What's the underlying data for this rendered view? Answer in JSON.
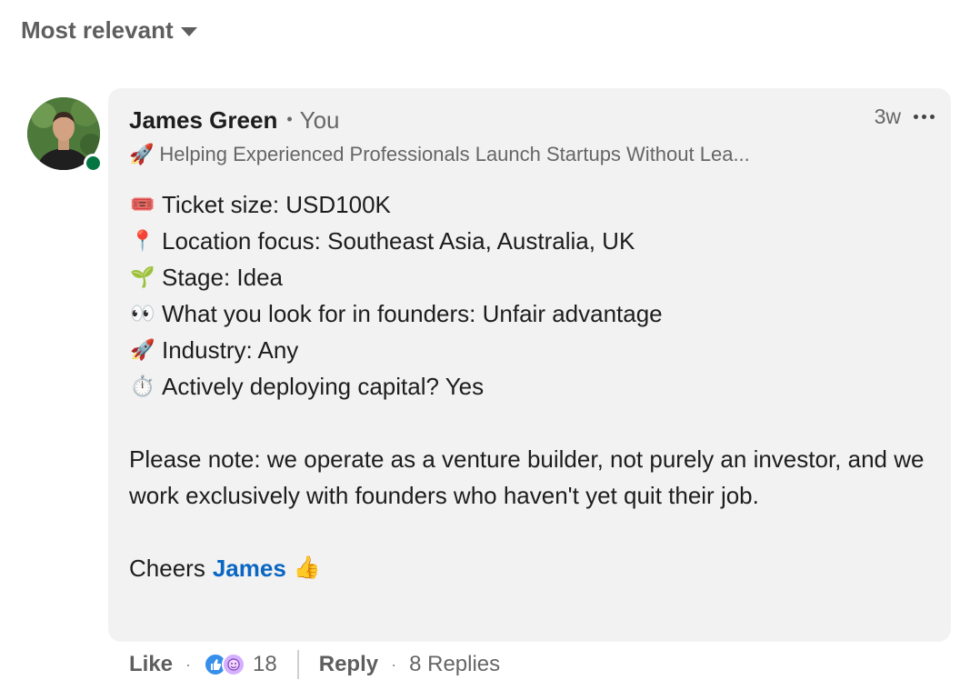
{
  "sort": {
    "label": "Most relevant",
    "icon": "caret-down-icon"
  },
  "comment": {
    "author": "James Green",
    "relation": "You",
    "headline_icon": "rocket",
    "headline": "Helping Experienced Professionals Launch Startups Without Lea...",
    "time": "3w",
    "presence_color": "#057642",
    "lines": [
      {
        "emoji": "🎟️",
        "icon": "ticket-icon",
        "text": "Ticket size: USD100K"
      },
      {
        "emoji": "📍",
        "icon": "pin-icon",
        "text": "Location focus: Southeast Asia, Australia, UK"
      },
      {
        "emoji": "🌱",
        "icon": "seedling-icon",
        "text": "Stage: Idea"
      },
      {
        "emoji": "👀",
        "icon": "eyes-icon",
        "text": "What you look for in founders: Unfair advantage"
      },
      {
        "emoji": "🚀",
        "icon": "rocket-icon",
        "text": "Industry: Any"
      },
      {
        "emoji": "⏱️",
        "icon": "stopwatch-icon",
        "text": "Actively deploying capital? Yes"
      }
    ],
    "paragraph": "Please note: we operate as a venture builder, not purely an investor, and we work exclusively with founders who haven't yet quit their job.",
    "cheers": "Cheers",
    "mention": "James",
    "thumb": "👍"
  },
  "actions": {
    "like": "Like",
    "reactions_count": "18",
    "reply": "Reply",
    "replies": "8 Replies",
    "accent_color": "#0a66c2"
  }
}
